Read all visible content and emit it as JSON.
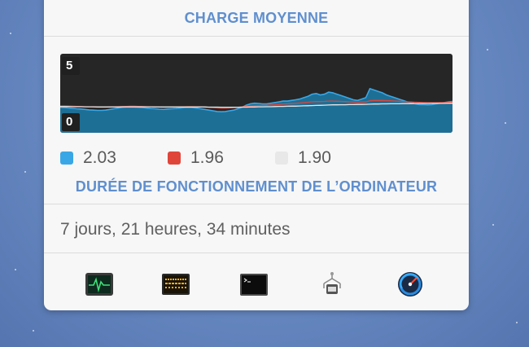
{
  "load_section": {
    "title": "CHARGE MOYENNE",
    "axis_max_label": "5",
    "axis_min_label": "0",
    "legend": [
      {
        "value": "2.03",
        "color": "#39a7e6",
        "icon": "blue-swatch"
      },
      {
        "value": "1.96",
        "color": "#e0453a",
        "icon": "red-swatch"
      },
      {
        "value": "1.90",
        "color": "#e8e8e8",
        "icon": "white-swatch"
      }
    ]
  },
  "uptime_section": {
    "title": "DURÉE DE FONCTIONNEMENT DE L’ORDINATEUR",
    "value": "7 jours, 21 heures, 34 minutes"
  },
  "toolbar": {
    "icons": [
      "activity-monitor-icon",
      "console-icon",
      "terminal-icon",
      "system-information-icon",
      "istat-menus-icon"
    ]
  },
  "chart_data": {
    "type": "area",
    "ylim": [
      0,
      5
    ],
    "series": [
      {
        "name": "",
        "color": "#39a7e6",
        "values": [
          1.6,
          1.58,
          1.56,
          1.53,
          1.5,
          1.48,
          1.45,
          1.42,
          1.4,
          1.38,
          1.38,
          1.4,
          1.45,
          1.5,
          1.55,
          1.6,
          1.62,
          1.63,
          1.62,
          1.6,
          1.58,
          1.55,
          1.52,
          1.5,
          1.47,
          1.45,
          1.48,
          1.5,
          1.52,
          1.55,
          1.58,
          1.6,
          1.58,
          1.55,
          1.5,
          1.45,
          1.4,
          1.35,
          1.3,
          1.28,
          1.3,
          1.35,
          1.4,
          1.5,
          1.6,
          1.75,
          1.85,
          1.9,
          1.88,
          1.85,
          1.85,
          1.9,
          1.95,
          2.0,
          2.05,
          2.05,
          2.1,
          2.15,
          2.2,
          2.3,
          2.4,
          2.55,
          2.6,
          2.5,
          2.55,
          2.7,
          2.65,
          2.55,
          2.45,
          2.35,
          2.25,
          2.15,
          2.1,
          2.2,
          2.3,
          2.95,
          2.85,
          2.75,
          2.65,
          2.5,
          2.4,
          2.3,
          2.2,
          2.1,
          2.0,
          1.95,
          1.85,
          1.8,
          1.8,
          1.78,
          1.8,
          1.85,
          1.9,
          1.95,
          2.0,
          2.03
        ]
      },
      {
        "name": "",
        "color": "#e0453a",
        "values": [
          1.7,
          1.7,
          1.69,
          1.68,
          1.67,
          1.66,
          1.65,
          1.64,
          1.63,
          1.62,
          1.62,
          1.62,
          1.63,
          1.64,
          1.65,
          1.66,
          1.67,
          1.68,
          1.68,
          1.67,
          1.66,
          1.65,
          1.64,
          1.63,
          1.62,
          1.61,
          1.61,
          1.62,
          1.62,
          1.63,
          1.64,
          1.65,
          1.65,
          1.64,
          1.63,
          1.62,
          1.6,
          1.58,
          1.56,
          1.55,
          1.55,
          1.56,
          1.58,
          1.6,
          1.63,
          1.67,
          1.7,
          1.72,
          1.73,
          1.74,
          1.75,
          1.77,
          1.79,
          1.81,
          1.83,
          1.85,
          1.87,
          1.89,
          1.91,
          1.94,
          1.97,
          2.0,
          2.02,
          2.02,
          2.03,
          2.05,
          2.05,
          2.04,
          2.03,
          2.02,
          2.0,
          1.98,
          1.97,
          1.98,
          1.99,
          2.08,
          2.1,
          2.1,
          2.1,
          2.09,
          2.08,
          2.06,
          2.04,
          2.02,
          2.0,
          1.99,
          1.97,
          1.96,
          1.95,
          1.94,
          1.94,
          1.94,
          1.95,
          1.95,
          1.96,
          1.96
        ]
      },
      {
        "name": "",
        "color": "#e8e8e8",
        "values": [
          1.66,
          1.66,
          1.66,
          1.65,
          1.65,
          1.65,
          1.64,
          1.64,
          1.64,
          1.63,
          1.63,
          1.63,
          1.63,
          1.63,
          1.63,
          1.64,
          1.64,
          1.64,
          1.64,
          1.64,
          1.64,
          1.64,
          1.64,
          1.63,
          1.63,
          1.63,
          1.63,
          1.63,
          1.63,
          1.63,
          1.63,
          1.63,
          1.63,
          1.63,
          1.63,
          1.63,
          1.62,
          1.62,
          1.62,
          1.61,
          1.61,
          1.61,
          1.61,
          1.61,
          1.62,
          1.62,
          1.63,
          1.63,
          1.64,
          1.64,
          1.65,
          1.65,
          1.66,
          1.67,
          1.67,
          1.68,
          1.69,
          1.69,
          1.7,
          1.71,
          1.72,
          1.73,
          1.74,
          1.75,
          1.76,
          1.77,
          1.78,
          1.78,
          1.79,
          1.79,
          1.8,
          1.8,
          1.81,
          1.81,
          1.82,
          1.83,
          1.84,
          1.84,
          1.85,
          1.85,
          1.86,
          1.86,
          1.86,
          1.87,
          1.87,
          1.87,
          1.88,
          1.88,
          1.88,
          1.88,
          1.89,
          1.89,
          1.89,
          1.89,
          1.9,
          1.9
        ]
      }
    ]
  }
}
